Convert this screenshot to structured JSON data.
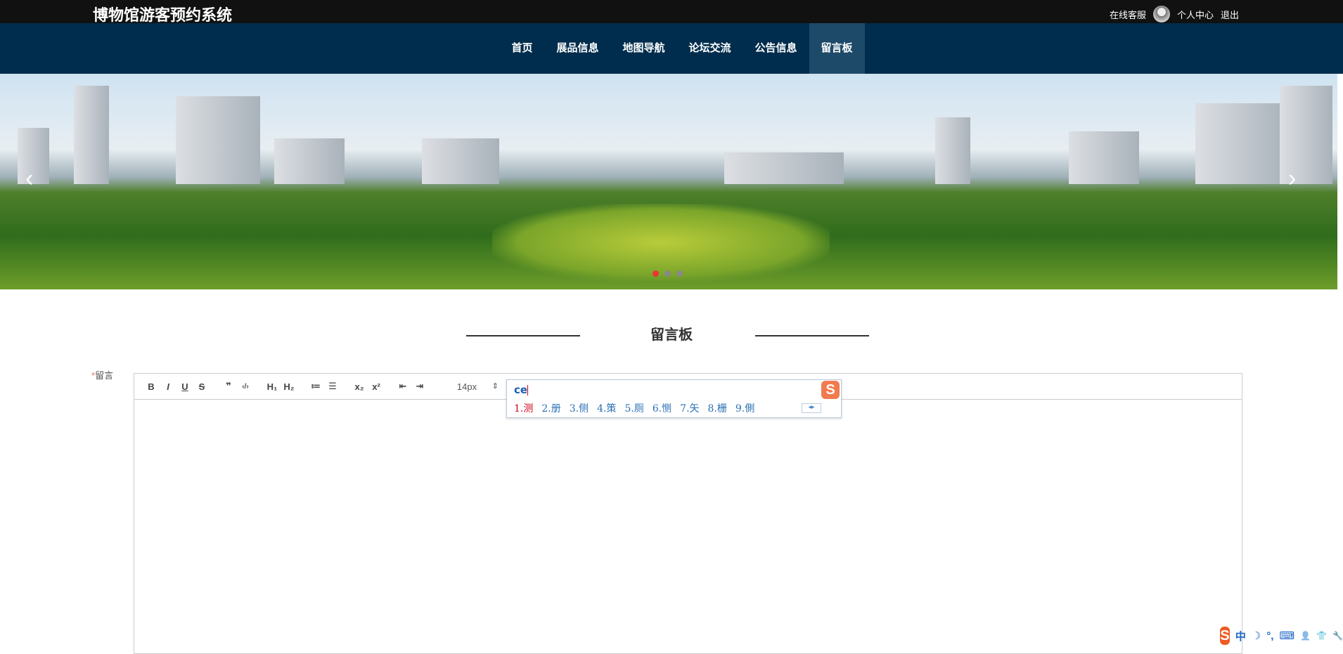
{
  "header": {
    "title": "博物馆游客预约系统",
    "user_links": [
      "在线客服",
      "个人中心",
      "退出"
    ]
  },
  "nav": {
    "items": [
      "首页",
      "展品信息",
      "地图导航",
      "论坛交流",
      "公告信息",
      "留言板"
    ],
    "active": "留言板"
  },
  "section": {
    "title": "留言板"
  },
  "form": {
    "label_required": "*",
    "label": "留言"
  },
  "toolbar": {
    "buttons": [
      "B",
      "I",
      "U",
      "S",
      "❞",
      "‹/›",
      "H₁",
      "H₂",
      "≔",
      "☰",
      "x₂",
      "x²",
      "⇤",
      "⇥"
    ],
    "font_size": "14px"
  },
  "ime": {
    "input": "ce",
    "candidates": [
      "1.测",
      "2.册",
      "3.侧",
      "4.策",
      "5.厕",
      "6.恻",
      "7.矢",
      "8.栅",
      "9.側"
    ],
    "pager": "◂▸",
    "logo": "S"
  },
  "tray": {
    "items": [
      "中",
      "☽",
      "°,",
      "⌨",
      "👤",
      "👕",
      "🔧"
    ]
  }
}
